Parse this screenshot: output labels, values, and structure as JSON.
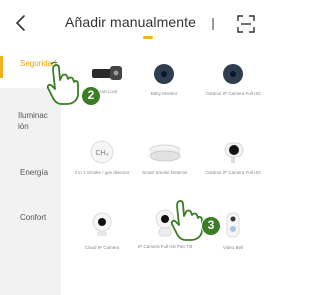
{
  "header": {
    "back_icon": "chevron-left-icon",
    "title": "Añadir manualmente",
    "accent_color": "#f0b21c",
    "scan_icon": "scan-frame-icon"
  },
  "sidebar": {
    "items": [
      {
        "label": "Seguridad",
        "active": true
      },
      {
        "label": "Iluminación",
        "active": false
      },
      {
        "label": "Energía",
        "active": false
      },
      {
        "label": "Confort",
        "active": false
      }
    ]
  },
  "devices": {
    "row1": [
      {
        "label": "Smart Lock",
        "icon": "smart-lock-icon"
      },
      {
        "label": "Baby Monitor",
        "icon": "baby-monitor-icon"
      },
      {
        "label": "Outdoor IP Camera Full HD",
        "icon": "outdoor-camera-icon"
      }
    ],
    "row2": [
      {
        "label": "2 in 1 Smoke / gas detector",
        "icon": "smoke-detector-icon"
      },
      {
        "label": "Smart Smoke Detector",
        "icon": "smoke-detector-icon"
      },
      {
        "label": "Outdoor IP Camera Full HD",
        "icon": "outdoor-camera-icon"
      }
    ],
    "row3": [
      {
        "label": "Cloud IP Camera",
        "icon": "cloud-camera-icon"
      },
      {
        "label": "IP Camera Full HD Pan Tilt",
        "icon": "pan-tilt-camera-icon"
      },
      {
        "label": "Video Bell",
        "icon": "video-bell-icon"
      }
    ]
  },
  "annotations": [
    {
      "number": "2",
      "icon": "hand-pointer-icon",
      "color": "#3a7d25"
    },
    {
      "number": "3",
      "icon": "hand-pointer-icon",
      "color": "#3a7d25"
    }
  ]
}
